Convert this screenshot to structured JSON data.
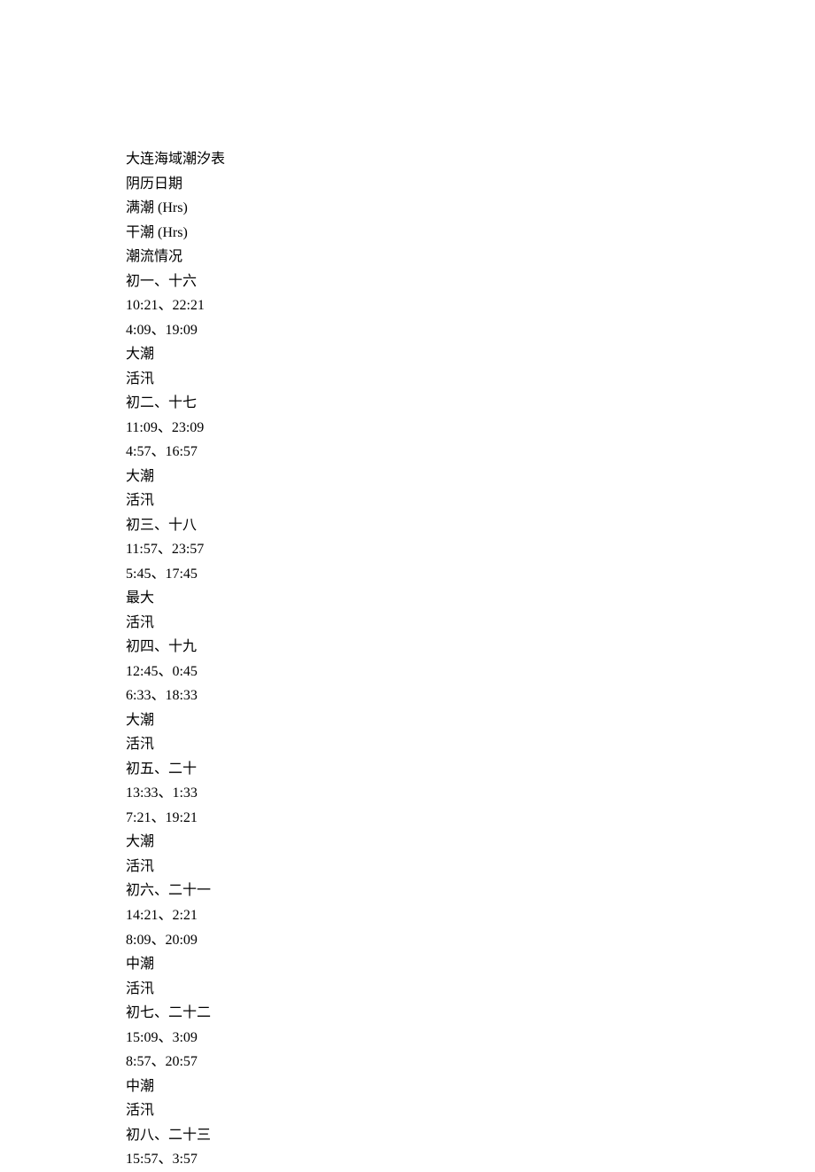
{
  "lines": [
    "大连海域潮汐表",
    "阴历日期",
    "满潮 (Hrs)",
    "干潮 (Hrs)",
    "潮流情况",
    "初一、十六",
    "10:21、22:21",
    "4:09、19:09",
    "大潮",
    "活汛",
    "初二、十七",
    "11:09、23:09",
    "4:57、16:57",
    "大潮",
    "活汛",
    "初三、十八",
    "11:57、23:57",
    "5:45、17:45",
    "最大",
    "活汛",
    "初四、十九",
    "12:45、0:45",
    "6:33、18:33",
    "大潮",
    "活汛",
    "初五、二十",
    "13:33、1:33",
    "7:21、19:21",
    "大潮",
    "活汛",
    "初六、二十一",
    "14:21、2:21",
    "8:09、20:09",
    "中潮",
    "活汛",
    "初七、二十二",
    "15:09、3:09",
    "8:57、20:57",
    "中潮",
    "活汛",
    "初八、二十三",
    "15:57、3:57"
  ]
}
